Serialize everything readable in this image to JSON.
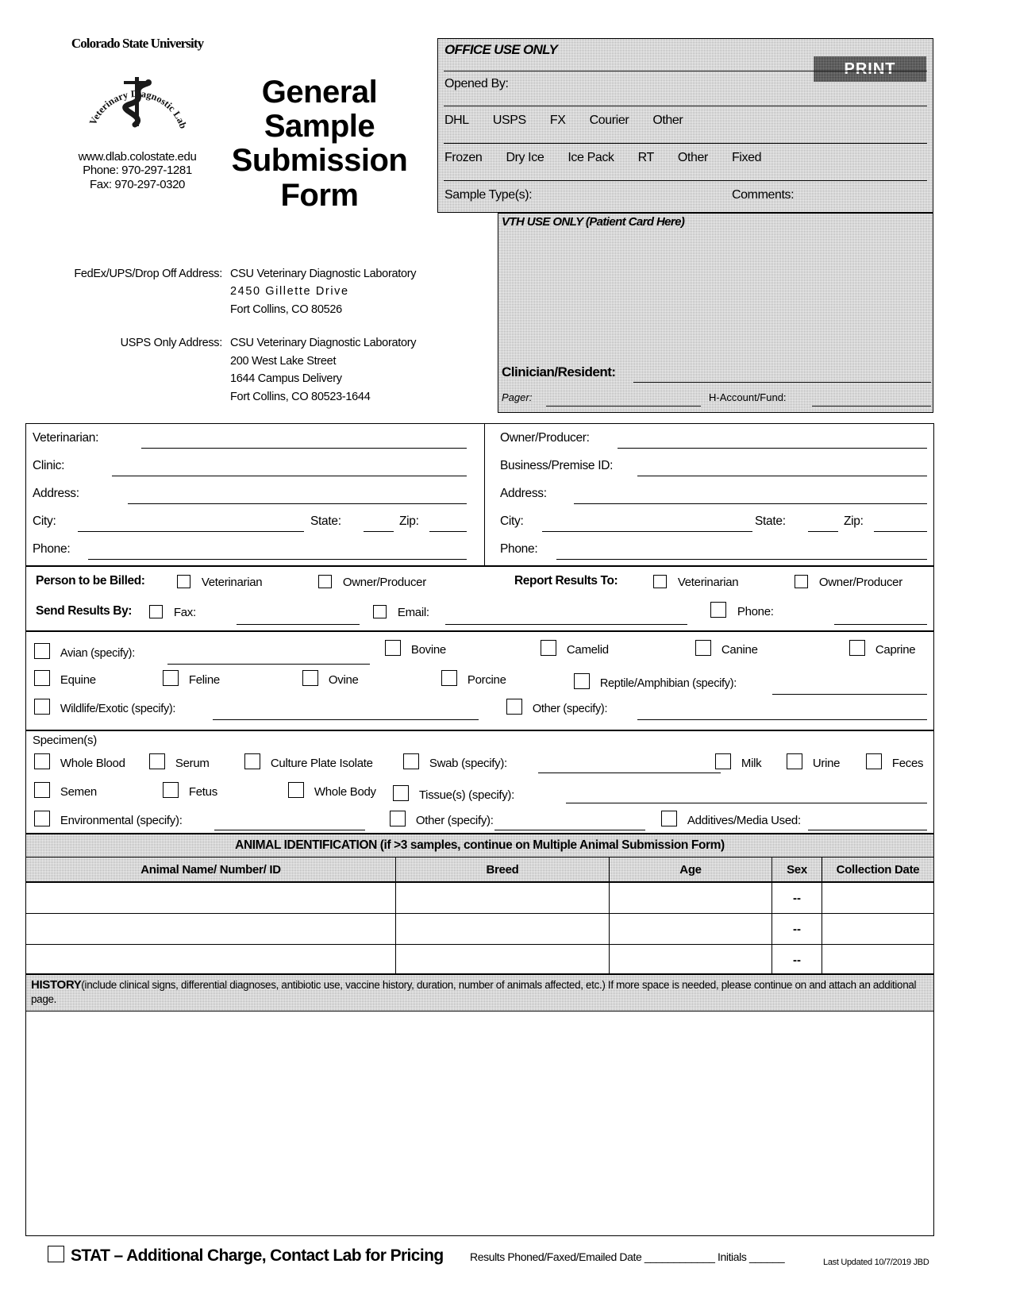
{
  "header": {
    "university": "Colorado State University",
    "seal_text": "Veterinary Diagnostic Laboratories",
    "website": "www.dlab.colostate.edu",
    "phone": "Phone: 970-297-1281",
    "fax": "Fax: 970-297-0320",
    "title_lines": [
      "General",
      "Sample",
      "Submission",
      "Form"
    ],
    "addresses": [
      {
        "label": "FedEx/UPS/Drop Off Address:",
        "lines": [
          "CSU Veterinary Diagnostic Laboratory",
          "2450 Gillette Drive",
          "Fort Collins, CO  80526"
        ]
      },
      {
        "label": "USPS Only Address:",
        "lines": [
          "CSU Veterinary Diagnostic Laboratory",
          "200 West Lake Street",
          "1644 Campus Delivery",
          "Fort Collins, CO  80523-1644"
        ]
      }
    ]
  },
  "office_use": {
    "title": "OFFICE USE ONLY",
    "print_label": "PRINT",
    "opened_by": "Opened By:",
    "carriers": [
      "DHL",
      "USPS",
      "FX",
      "Courier",
      "Other"
    ],
    "conditions": [
      "Frozen",
      "Dry Ice",
      "Ice Pack",
      "RT",
      "Other",
      "Fixed"
    ],
    "sample_types": "Sample Type(s):",
    "comments": "Comments:"
  },
  "vth": {
    "title": "VTH USE ONLY (Patient Card Here)",
    "clinician": "Clinician/Resident:",
    "pager": "Pager:",
    "account": "H-Account/Fund:"
  },
  "contacts": {
    "left": [
      {
        "label": "Veterinarian:"
      },
      {
        "label": "Clinic:"
      },
      {
        "label": "Address:"
      },
      {
        "label": "City:",
        "label2": "State:",
        "label3": "Zip:"
      },
      {
        "label": "Phone:"
      }
    ],
    "right": [
      {
        "label": "Owner/Producer:"
      },
      {
        "label": "Business/Premise ID:"
      },
      {
        "label": "Address:"
      },
      {
        "label": "City:",
        "label2": "State:",
        "label3": "Zip:"
      },
      {
        "label": "Phone:"
      }
    ]
  },
  "billing": {
    "person_billed_label": "Person to be Billed:",
    "person_billed_options": [
      "Veterinarian",
      "Owner/Producer"
    ],
    "report_results_label": "Report Results To:",
    "report_results_options": [
      "Veterinarian",
      "Owner/Producer"
    ],
    "send_results_label": "Send Results By:",
    "send_results_options": [
      "Fax:",
      "Email:",
      "Phone:"
    ]
  },
  "species": {
    "row1": [
      "Avian (specify):",
      "Bovine",
      "Camelid",
      "Canine",
      "Caprine"
    ],
    "row2": [
      "Equine",
      "Feline",
      "Ovine",
      "Porcine",
      "Reptile/Amphibian (specify):"
    ],
    "row3": [
      "Wildlife/Exotic (specify):",
      "Other (specify):"
    ]
  },
  "specimens": {
    "heading": "Specimen(s)",
    "row1": [
      "Whole Blood",
      "Serum",
      "Culture Plate Isolate",
      "Swab (specify):",
      "Milk",
      "Urine",
      "Feces"
    ],
    "row2": [
      "Semen",
      "Fetus",
      "Whole Body",
      "Tissue(s) (specify):"
    ],
    "row3": [
      "Environmental (specify):",
      "Other (specify):",
      "Additives/Media Used:"
    ]
  },
  "animal_table": {
    "title": "ANIMAL IDENTIFICATION (if >3 samples, continue on Multiple Animal Submission Form)",
    "columns": [
      "Animal Name/ Number/ ID",
      "Breed",
      "Age",
      "Sex",
      "Collection Date"
    ],
    "rows": [
      {
        "name": "",
        "breed": "",
        "age": "",
        "sex": "--",
        "date": ""
      },
      {
        "name": "",
        "breed": "",
        "age": "",
        "sex": "--",
        "date": ""
      },
      {
        "name": "",
        "breed": "",
        "age": "",
        "sex": "--",
        "date": ""
      }
    ]
  },
  "history": {
    "heading": "HISTORY",
    "instructions": "(include clinical signs, differential diagnoses, antibiotic use, vaccine history, duration, number of animals affected, etc.)  If more space is needed, please continue on and attach an additional page.",
    "value": ""
  },
  "footer": {
    "stat": "STAT – Additional Charge, Contact Lab for Pricing",
    "results_line": "Results Phoned/Faxed/Emailed  Date ____________    Initials ______",
    "last_updated": "Last Updated 10/7/2019 JBD"
  }
}
